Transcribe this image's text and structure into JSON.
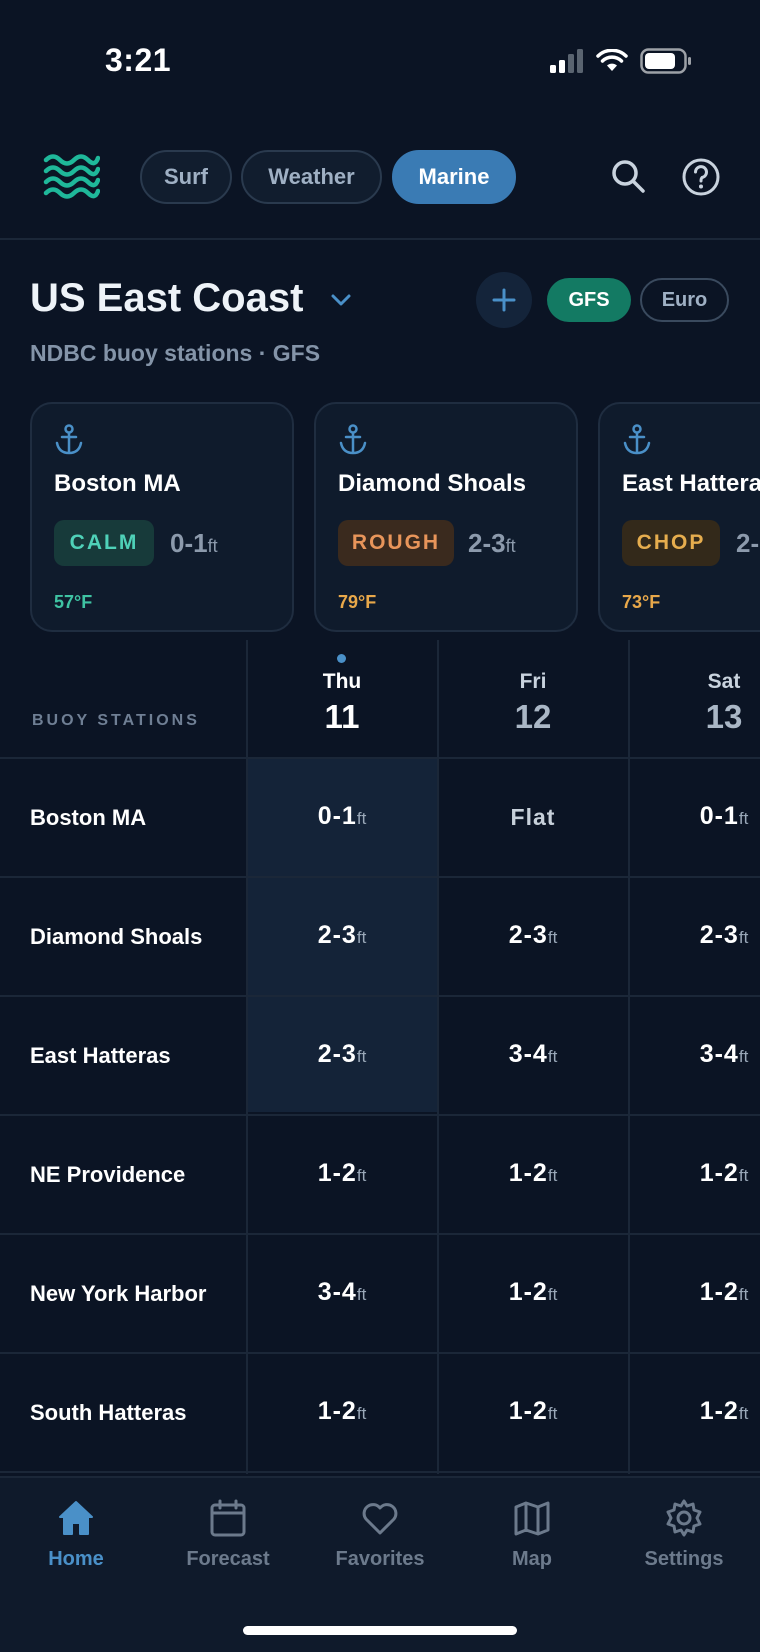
{
  "status_bar": {
    "time": "3:21"
  },
  "nav": {
    "tabs": [
      {
        "label": "Surf"
      },
      {
        "label": "Weather"
      },
      {
        "label": "Marine",
        "active": true
      }
    ]
  },
  "region": {
    "title": "US East Coast",
    "subtitle": "NDBC buoy stations · GFS",
    "models": [
      {
        "label": "GFS",
        "active": true
      },
      {
        "label": "Euro"
      }
    ]
  },
  "cards": [
    {
      "name": "Boston MA",
      "condition": "CALM",
      "height": "0-1",
      "unit": "ft",
      "temp": "57°F",
      "badge_bg": "#173a3a",
      "badge_fg": "#4fd1b8",
      "temp_color": "#3fc3a3"
    },
    {
      "name": "Diamond Shoals",
      "condition": "ROUGH",
      "height": "2-3",
      "unit": "ft",
      "temp": "79°F",
      "badge_bg": "#3a2a1e",
      "badge_fg": "#e8955a",
      "temp_color": "#e8a84a"
    },
    {
      "name": "East Hatteras",
      "condition": "CHOP",
      "height": "2-",
      "unit": "",
      "temp": "73°F",
      "badge_bg": "#33291a",
      "badge_fg": "#e6ad4e",
      "temp_color": "#e8a84a"
    }
  ],
  "table": {
    "header_label": "BUOY STATIONS",
    "days": [
      {
        "name": "Thu",
        "date": "11",
        "active": true
      },
      {
        "name": "Fri",
        "date": "12"
      },
      {
        "name": "Sat",
        "date": "13"
      }
    ],
    "unit": "ft",
    "rows": [
      {
        "station": "Boston MA",
        "values": [
          "0-1",
          "Flat",
          "0-1"
        ]
      },
      {
        "station": "Diamond Shoals",
        "values": [
          "2-3",
          "2-3",
          "2-3"
        ]
      },
      {
        "station": "East Hatteras",
        "values": [
          "2-3",
          "3-4",
          "3-4"
        ]
      },
      {
        "station": "NE Providence",
        "values": [
          "1-2",
          "1-2",
          "1-2"
        ]
      },
      {
        "station": "New York Harbor",
        "values": [
          "3-4",
          "1-2",
          "1-2"
        ]
      },
      {
        "station": "South Hatteras",
        "values": [
          "1-2",
          "1-2",
          "1-2"
        ]
      }
    ]
  },
  "tabbar": [
    {
      "label": "Home",
      "icon": "home-icon",
      "active": true
    },
    {
      "label": "Forecast",
      "icon": "calendar-icon"
    },
    {
      "label": "Favorites",
      "icon": "heart-icon"
    },
    {
      "label": "Map",
      "icon": "map-icon"
    },
    {
      "label": "Settings",
      "icon": "gear-icon"
    }
  ],
  "colors": {
    "accent": "#3a7bb4",
    "background": "#0b1424",
    "gfs": "#137a63"
  }
}
